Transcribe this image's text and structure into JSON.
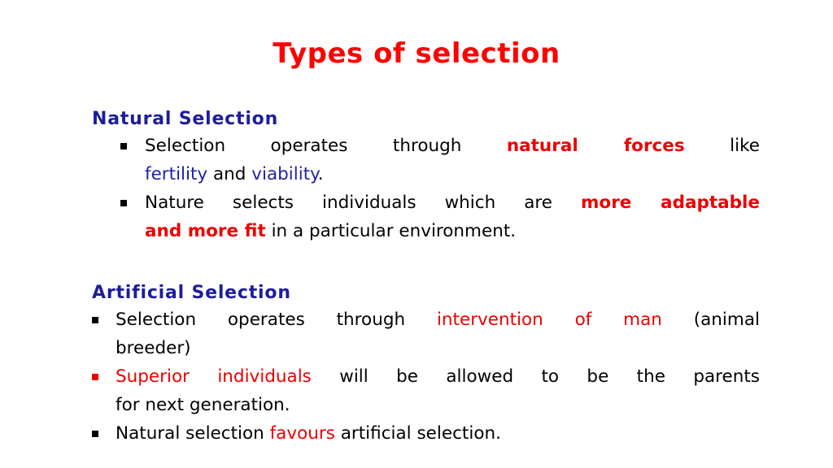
{
  "slide": {
    "title": "Types of selection",
    "title_color": "#ff0000",
    "background_color": "#ffffff",
    "heading_color": "#1d1d9c",
    "accent_red": "#ee0000",
    "accent_blue": "#2222a8",
    "body_color": "#000000"
  },
  "sections": [
    {
      "heading": "Natural Selection",
      "bullets": [
        {
          "marker": "square-bullet",
          "marker_color": "#000000",
          "lines": [
            {
              "justify": true,
              "runs": [
                {
                  "text": "Selection operates through ",
                  "style": "black"
                },
                {
                  "text": "natural forces",
                  "style": "red-bold"
                },
                {
                  "text": " like",
                  "style": "black"
                }
              ]
            },
            {
              "justify": false,
              "runs": [
                {
                  "text": "fertility",
                  "style": "blue"
                },
                {
                  "text": " and ",
                  "style": "black"
                },
                {
                  "text": "viability",
                  "style": "blue"
                },
                {
                  "text": ".",
                  "style": "black"
                }
              ]
            }
          ]
        },
        {
          "marker": "square-bullet",
          "marker_color": "#000000",
          "lines": [
            {
              "justify": true,
              "runs": [
                {
                  "text": "Nature selects individuals which are ",
                  "style": "black"
                },
                {
                  "text": "more adaptable",
                  "style": "red-bold"
                }
              ]
            },
            {
              "justify": false,
              "runs": [
                {
                  "text": "and more fit",
                  "style": "red-bold"
                },
                {
                  "text": " in a particular environment.",
                  "style": "black"
                }
              ]
            }
          ]
        }
      ]
    },
    {
      "heading": "Artificial Selection",
      "bullets": [
        {
          "marker": "square-bullet",
          "marker_color": "#000000",
          "lines": [
            {
              "justify": true,
              "runs": [
                {
                  "text": "Selection operates through ",
                  "style": "black"
                },
                {
                  "text": "intervention of man",
                  "style": "red"
                },
                {
                  "text": " (animal",
                  "style": "black"
                }
              ]
            },
            {
              "justify": false,
              "runs": [
                {
                  "text": "breeder)",
                  "style": "black"
                }
              ]
            }
          ]
        },
        {
          "marker": "square-bullet",
          "marker_color": "#ee0000",
          "lines": [
            {
              "justify": true,
              "runs": [
                {
                  "text": "Superior individuals",
                  "style": "red"
                },
                {
                  "text": " will be allowed to be the parents",
                  "style": "black"
                }
              ]
            },
            {
              "justify": false,
              "runs": [
                {
                  "text": "for next generation.",
                  "style": "black"
                }
              ]
            }
          ]
        },
        {
          "marker": "square-bullet",
          "marker_color": "#000000",
          "lines": [
            {
              "justify": false,
              "runs": [
                {
                  "text": "Natural selection ",
                  "style": "black"
                },
                {
                  "text": "favours",
                  "style": "red"
                },
                {
                  "text": " artificial selection.",
                  "style": "black"
                }
              ]
            }
          ]
        }
      ]
    }
  ]
}
